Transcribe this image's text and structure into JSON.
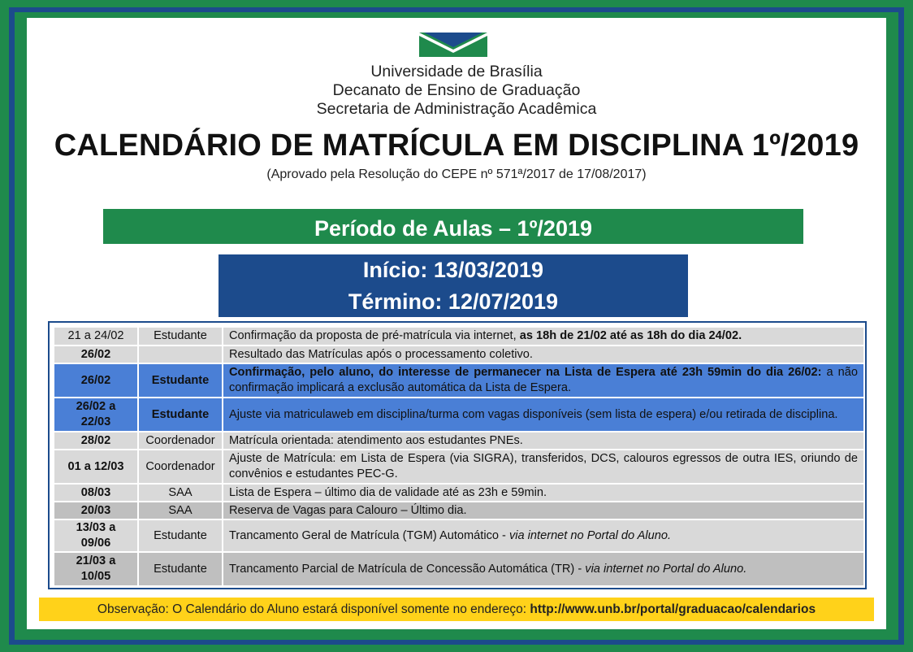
{
  "header": {
    "line1": "Universidade de Brasília",
    "line2": "Decanato de Ensino de Graduação",
    "line3": "Secretaria de Administração Acadêmica"
  },
  "title": "CALENDÁRIO DE MATRÍCULA EM DISCIPLINA 1º/2019",
  "subtitle": "(Aprovado pela Resolução do CEPE nº 571ª/2017 de 17/08/2017)",
  "periodo": "Período de Aulas – 1º/2019",
  "inicio": "Início: 13/03/2019",
  "termino": "Término: 12/07/2019",
  "rows": [
    {
      "date": "21 a 24/02",
      "who": "Estudante",
      "desc": "Confirmação da proposta de pré-matrícula via internet, ",
      "desc_bold": "as 18h de 21/02 até as 18h do dia 24/02."
    },
    {
      "date": "26/02",
      "who": "",
      "desc": "Resultado das Matrículas após o processamento coletivo."
    },
    {
      "date": "26/02",
      "who": "Estudante",
      "desc_bold": "Confirmação, pelo aluno, do interesse de permanecer na Lista de Espera até 23h 59min do dia 26/02:",
      "desc": " a não confirmação implicará a exclusão automática da Lista de Espera."
    },
    {
      "date": "26/02 a 22/03",
      "who": "Estudante",
      "desc": "Ajuste via matriculaweb em disciplina/turma com vagas disponíveis (sem lista de espera) e/ou retirada de disciplina."
    },
    {
      "date": "28/02",
      "who": "Coordenador",
      "desc": "Matrícula orientada: atendimento aos estudantes PNEs."
    },
    {
      "date": "01 a 12/03",
      "who": "Coordenador",
      "desc": "Ajuste de Matrícula: em Lista de Espera (via SIGRA), transferidos, DCS, calouros egressos de outra IES, oriundo de convênios e estudantes PEC-G."
    },
    {
      "date": "08/03",
      "who": "SAA",
      "desc": "Lista de Espera – último dia de validade até as 23h e 59min."
    },
    {
      "date": "20/03",
      "who": "SAA",
      "desc": "Reserva de Vagas para Calouro – Último dia."
    },
    {
      "date": "13/03 a 09/06",
      "who": "Estudante",
      "desc": "Trancamento Geral de Matrícula (TGM) Automático - ",
      "desc_italic": "via internet no Portal do Aluno."
    },
    {
      "date": "21/03 a 10/05",
      "who": "Estudante",
      "desc": "Trancamento Parcial de Matrícula de Concessão Automática (TR) - ",
      "desc_italic": "via internet no Portal do Aluno."
    }
  ],
  "observacao": {
    "text": "Observação: O Calendário do Aluno estará disponível somente no endereço: ",
    "url": "http://www.unb.br/portal/graduacao/calendarios"
  },
  "colors": {
    "green": "#1f8a4c",
    "blue": "#1c4b8c",
    "row_blue": "#4a7fd6",
    "yellow": "#ffd21a"
  }
}
